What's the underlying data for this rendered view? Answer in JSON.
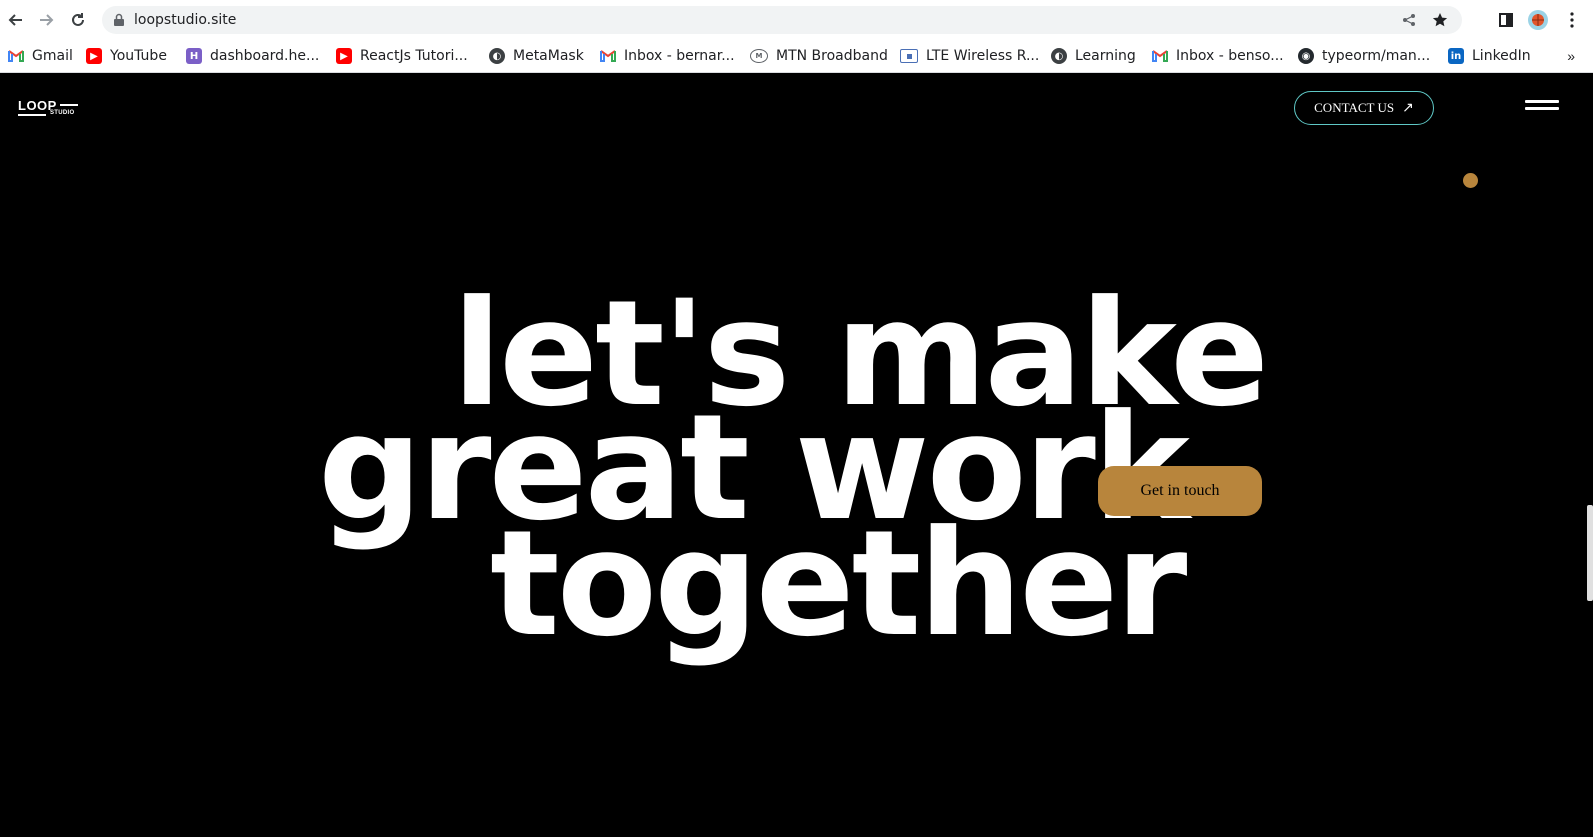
{
  "browser": {
    "url": "loopstudio.site",
    "bookmarks": [
      {
        "label": "Gmail",
        "icon": "gmail-icon"
      },
      {
        "label": "YouTube",
        "icon": "youtube-icon"
      },
      {
        "label": "dashboard.he...",
        "icon": "heroku-icon"
      },
      {
        "label": "ReactJs Tutori...",
        "icon": "youtube-icon"
      },
      {
        "label": "MetaMask",
        "icon": "globe-icon"
      },
      {
        "label": "Inbox - bernar...",
        "icon": "gmail-icon"
      },
      {
        "label": "MTN Broadband",
        "icon": "mtn-icon"
      },
      {
        "label": "LTE Wireless R...",
        "icon": "router-icon"
      },
      {
        "label": "Learning",
        "icon": "globe-icon"
      },
      {
        "label": "Inbox - benso...",
        "icon": "gmail-icon"
      },
      {
        "label": "typeorm/man...",
        "icon": "github-icon"
      },
      {
        "label": "LinkedIn",
        "icon": "linkedin-icon"
      }
    ],
    "more_bookmarks": "»"
  },
  "site": {
    "logo": {
      "main": "LOOP",
      "sub": "STUDIO"
    },
    "contact_label": "CONTACT US",
    "contact_arrow": "↗",
    "headline": [
      "let's make",
      "great work",
      "together"
    ],
    "cta_label": "Get in touch",
    "accent_color": "#b8853c",
    "contact_border_color": "#5fc8c6"
  }
}
